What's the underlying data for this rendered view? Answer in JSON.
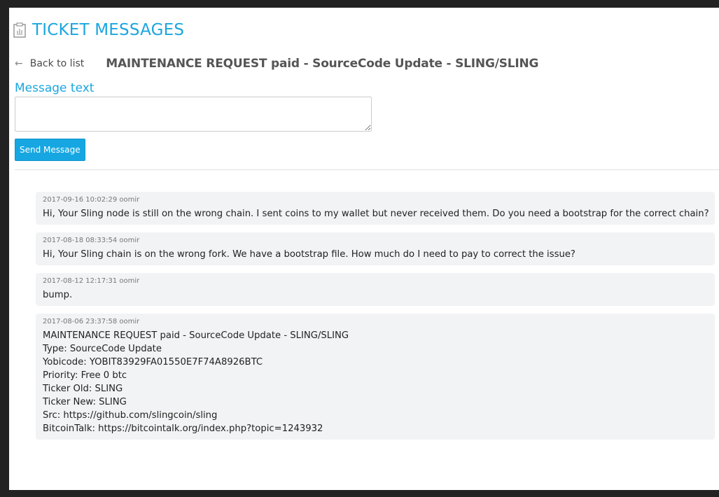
{
  "page": {
    "title": "TICKET MESSAGES",
    "title_icon": "clipboard-chart-icon",
    "accent_color": "#1ba6df"
  },
  "nav": {
    "back_label": "Back to list",
    "back_icon": "arrow-left-icon",
    "ticket_title": "MAINTENANCE REQUEST paid - SourceCode Update - SLING/SLING"
  },
  "form": {
    "label": "Message text",
    "textarea_value": "",
    "send_label": "Send Message",
    "send_color": "#16a7e2"
  },
  "messages": [
    {
      "meta": "2017-09-16 10:02:29 oomir",
      "lines": [
        "Hi, Your Sling node is still on the wrong chain.  I sent coins to my wallet but never received them.  Do you need a bootstrap for the correct chain?"
      ]
    },
    {
      "meta": "2017-08-18 08:33:54 oomir",
      "lines": [
        "Hi, Your Sling chain is on the wrong fork. We have a bootstrap file.  How much do I need to pay to correct the issue?"
      ]
    },
    {
      "meta": "2017-08-12 12:17:31 oomir",
      "lines": [
        "bump."
      ]
    },
    {
      "meta": "2017-08-06 23:37:58 oomir",
      "lines": [
        "MAINTENANCE REQUEST paid - SourceCode Update - SLING/SLING",
        "Type: SourceCode Update",
        "Yobicode: YOBIT83929FA01550E7F74A8926BTC",
        "Priority: Free 0 btc",
        "Ticker Old: SLING",
        "Ticker New: SLING",
        "Src: https://github.com/slingcoin/sling",
        "BitcoinTalk: https://bitcointalk.org/index.php?topic=1243932"
      ]
    }
  ]
}
